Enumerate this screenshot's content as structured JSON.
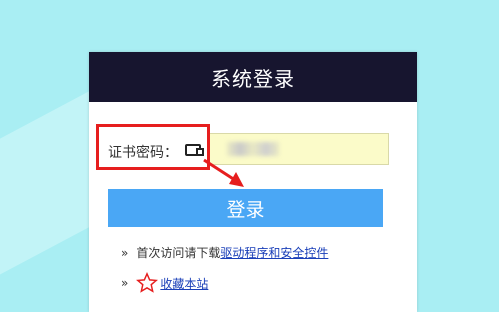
{
  "panel": {
    "title": "系统登录"
  },
  "cert": {
    "label": "证书密码：",
    "value": ""
  },
  "login_button": "登录",
  "links": {
    "download_prefix": "首次访问请下载",
    "download_link": "驱动程序和安全控件",
    "bookmark_link": "收藏本站",
    "bullet": "»"
  },
  "annotation": {
    "color": "#e61e1e"
  },
  "colors": {
    "background": "#a9eef3",
    "header": "#17152f",
    "button": "#4aa7f5",
    "input": "#fbfbc9"
  }
}
